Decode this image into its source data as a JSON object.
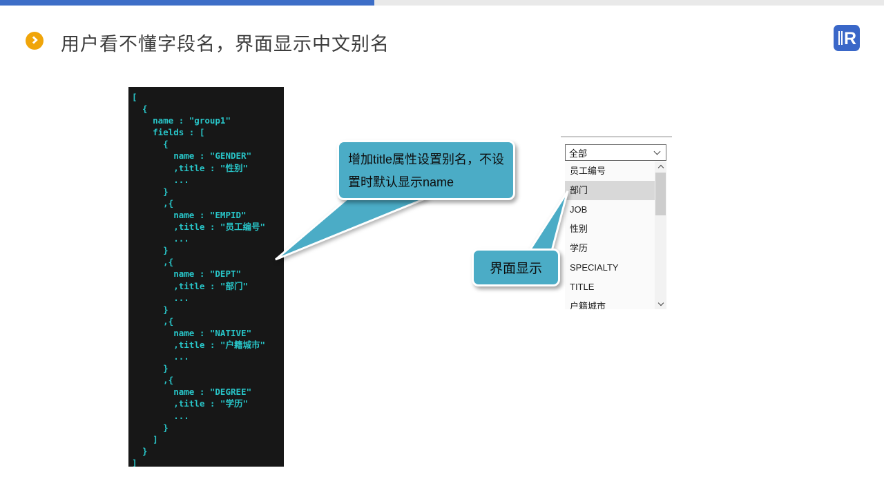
{
  "slide": {
    "title": "用户看不懂字段名，界面显示中文别名"
  },
  "logo": {
    "letter": "R"
  },
  "code_block": {
    "lines": [
      "[",
      "  {",
      "    name : \"group1\"",
      "    fields : [",
      "      {",
      "        name : \"GENDER\"",
      "        ,title : \"性别\"",
      "        ...",
      "      }",
      "      ,{",
      "        name : \"EMPID\"",
      "        ,title : \"员工编号\"",
      "        ...",
      "      }",
      "      ,{",
      "        name : \"DEPT\"",
      "        ,title : \"部门\"",
      "        ...",
      "      }",
      "      ,{",
      "        name : \"NATIVE\"",
      "        ,title : \"户籍城市\"",
      "        ...",
      "      }",
      "      ,{",
      "        name : \"DEGREE\"",
      "        ,title : \"学历\"",
      "        ...",
      "      }",
      "    ]",
      "  }",
      "]"
    ]
  },
  "callouts": {
    "callout1": "增加title属性设置别名，不设置时默认显示name",
    "callout2": "界面显示"
  },
  "dropdown": {
    "selected": "全部",
    "items": [
      {
        "label": "员工编号",
        "highlighted": false
      },
      {
        "label": "部门",
        "highlighted": true
      },
      {
        "label": "JOB",
        "highlighted": false
      },
      {
        "label": "性别",
        "highlighted": false
      },
      {
        "label": "学历",
        "highlighted": false
      },
      {
        "label": "SPECIALTY",
        "highlighted": false
      },
      {
        "label": "TITLE",
        "highlighted": false
      },
      {
        "label": "户籍城市",
        "highlighted": false
      }
    ]
  },
  "colors": {
    "topbar_blue": "#3D6EC7",
    "topbar_gray": "#E9E9E9",
    "bullet_orange": "#F0A50A",
    "code_bg": "#171717",
    "code_text": "#28C5C8",
    "callout_teal": "#4BACC6",
    "highlight_gray": "#D8D8D8",
    "logo_blue": "#3A67C8"
  }
}
